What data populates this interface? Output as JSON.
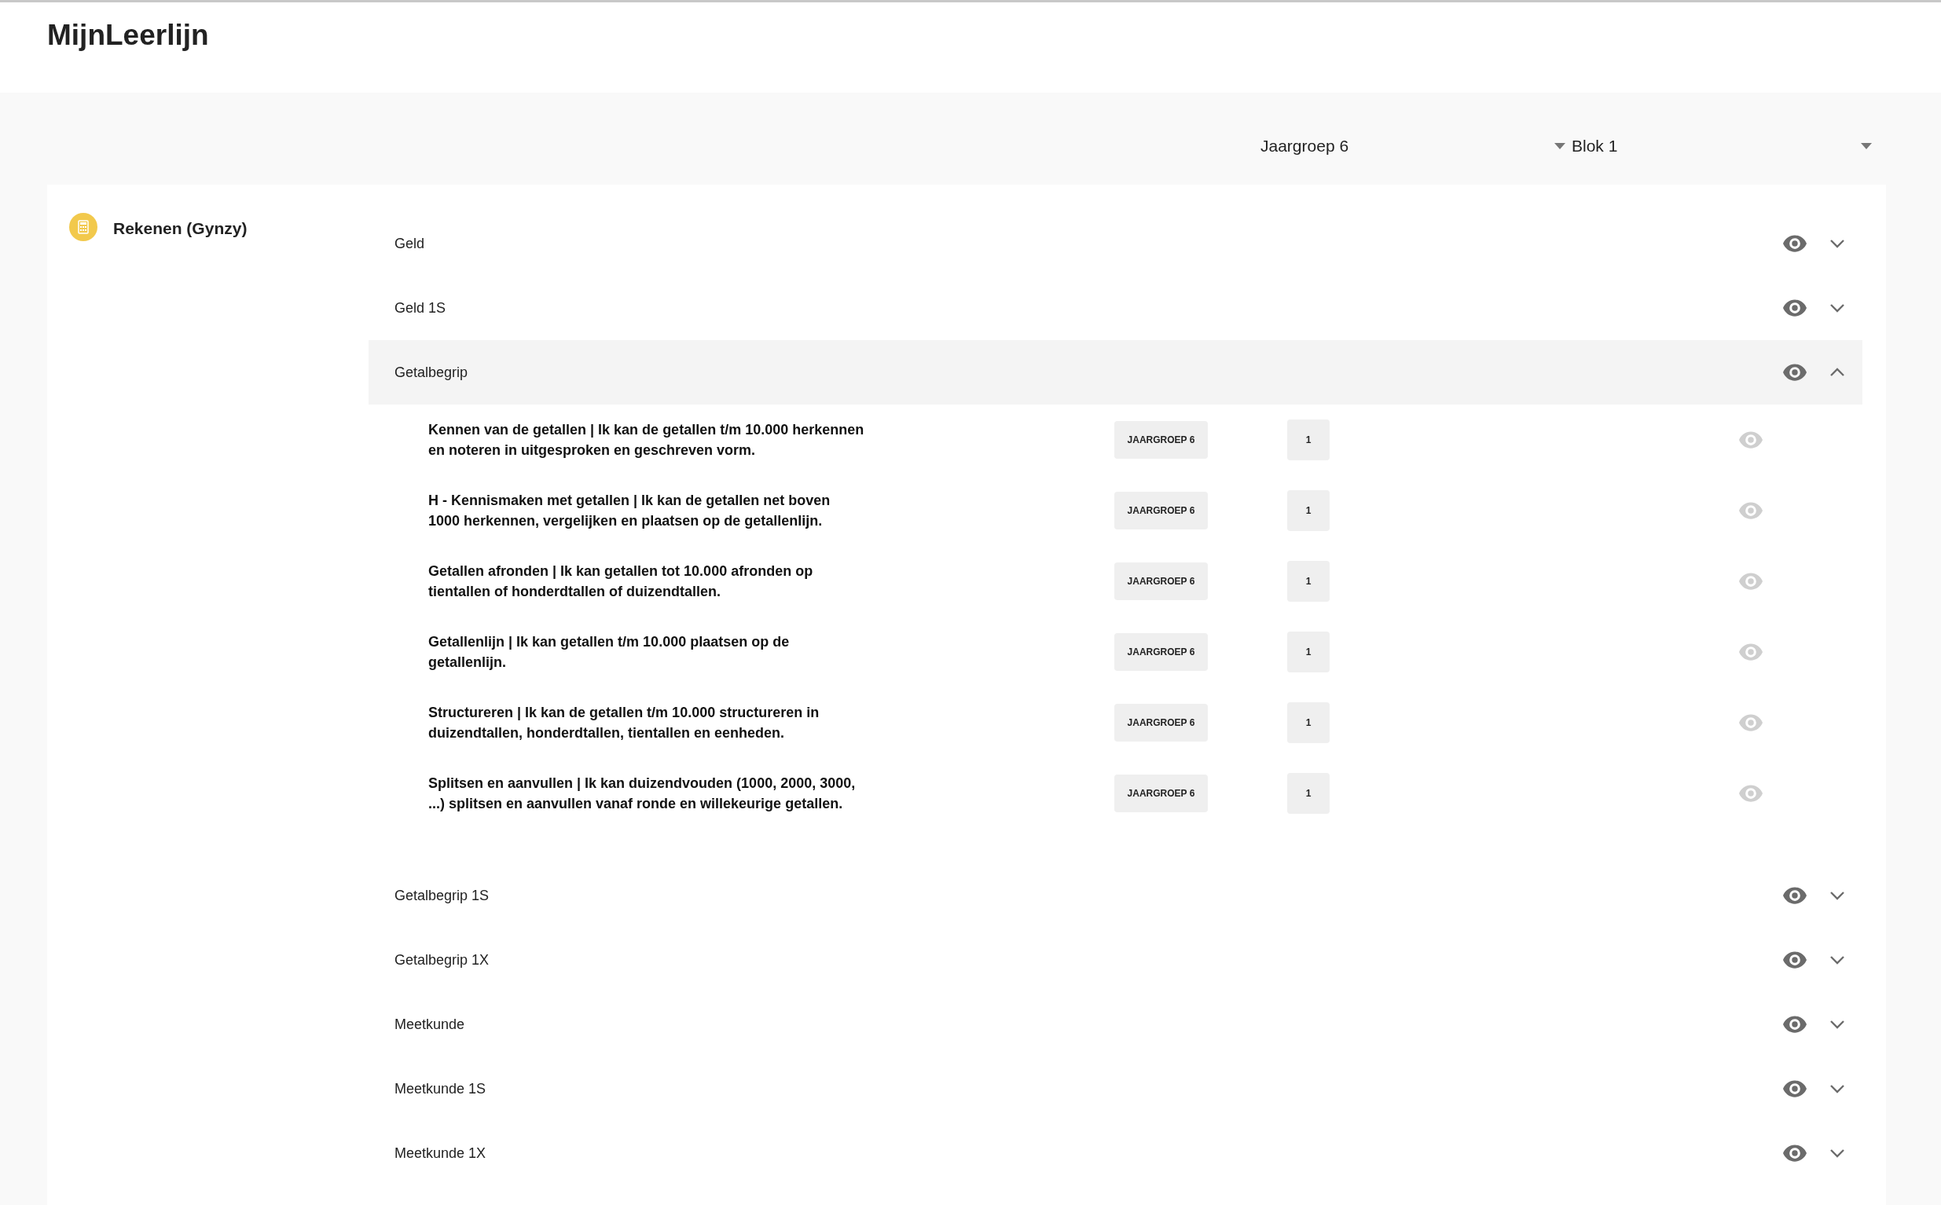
{
  "app_title": "MijnLeerlijn",
  "filters": [
    {
      "value": "Jaargroep 6"
    },
    {
      "value": "Blok 1"
    }
  ],
  "subject": {
    "name": "Rekenen (Gynzy)"
  },
  "topics": [
    {
      "label": "Geld",
      "expanded": false,
      "visible": true
    },
    {
      "label": "Geld 1S",
      "expanded": false,
      "visible": true
    },
    {
      "label": "Getalbegrip",
      "expanded": true,
      "visible": true,
      "items": [
        {
          "text": "Kennen van de getallen | Ik kan de getallen t/m 10.000 herkennen en noteren in uitgesproken en geschreven vorm.",
          "group": "JAARGROEP 6",
          "block": "1",
          "visible": false
        },
        {
          "text": "H - Kennismaken met getallen | Ik kan de getallen net boven 1000 herkennen, vergelijken en plaatsen op de getallenlijn.",
          "group": "JAARGROEP 6",
          "block": "1",
          "visible": false
        },
        {
          "text": "Getallen afronden | Ik kan getallen tot 10.000 afronden op tientallen of honderdtallen of duizendtallen.",
          "group": "JAARGROEP 6",
          "block": "1",
          "visible": false
        },
        {
          "text": "Getallenlijn | Ik kan getallen t/m 10.000 plaatsen op de getallenlijn.",
          "group": "JAARGROEP 6",
          "block": "1",
          "visible": false
        },
        {
          "text": "Structureren | Ik kan de getallen t/m 10.000 structureren in duizendtallen, honderdtallen, tientallen en eenheden.",
          "group": "JAARGROEP 6",
          "block": "1",
          "visible": false
        },
        {
          "text": "Splitsen en aanvullen | Ik kan duizendvouden (1000, 2000, 3000, ...) splitsen en aanvullen vanaf ronde en willekeurige getallen.",
          "group": "JAARGROEP 6",
          "block": "1",
          "visible": false
        }
      ]
    },
    {
      "label": "Getalbegrip 1S",
      "expanded": false,
      "visible": true
    },
    {
      "label": "Getalbegrip 1X",
      "expanded": false,
      "visible": true
    },
    {
      "label": "Meetkunde",
      "expanded": false,
      "visible": true
    },
    {
      "label": "Meetkunde 1S",
      "expanded": false,
      "visible": true
    },
    {
      "label": "Meetkunde 1X",
      "expanded": false,
      "visible": true
    }
  ]
}
